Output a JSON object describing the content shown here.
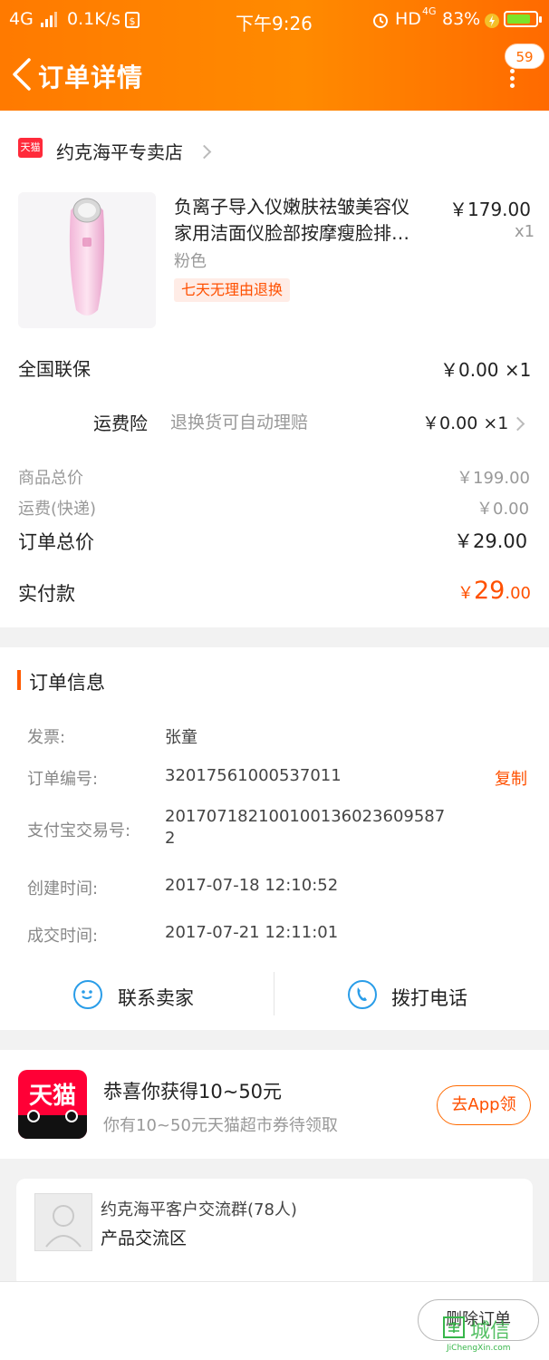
{
  "status_bar": {
    "network": "4G",
    "speed": "0.1K/s",
    "time": "下午9:26",
    "hd": "HD",
    "hd_net": "4G",
    "battery": "83%",
    "battery_level": 0.83
  },
  "header": {
    "title": "订单详情",
    "badge": "59"
  },
  "store": {
    "tag": "天猫",
    "name": "约克海平专卖店"
  },
  "product": {
    "title_line1": "负离子导入仪嫩肤祛皱美容仪",
    "title_line2": "家用洁面仪脸部按摩瘦脸排…",
    "price": "￥179.00",
    "qty": "x1",
    "spec": "粉色",
    "tag": "七天无理由退换"
  },
  "services": [
    {
      "name": "全国联保",
      "value": "￥0.00 ×1"
    },
    {
      "name": "运费险",
      "desc": "退换货可自动理赔",
      "value": "￥0.00 ×1"
    }
  ],
  "summary": {
    "goods_label": "商品总价",
    "goods_value": "￥199.00",
    "ship_label": "运费(快递)",
    "ship_value": "￥0.00",
    "total_label": "订单总价",
    "total_value": "￥29.00",
    "paid_label": "实付款",
    "paid_symbol": "￥",
    "paid_int": "29",
    "paid_dec": ".00"
  },
  "order_info": {
    "title": "订单信息",
    "invoice_label": "发票:",
    "invoice_value": "张童",
    "order_no_label": "订单编号:",
    "order_no_value": "32017561000537011",
    "copy": "复制",
    "alipay_label": "支付宝交易号:",
    "alipay_line1": "201707182100100136023609587",
    "alipay_line2": "2",
    "create_label": "创建时间:",
    "create_value": "2017-07-18 12:10:52",
    "deal_label": "成交时间:",
    "deal_value": "2017-07-21 12:11:01"
  },
  "actions": {
    "contact": "联系卖家",
    "call": "拨打电话"
  },
  "promo": {
    "logo_text": "天猫",
    "title": "恭喜你获得10~50元",
    "subtitle": "你有10~50元天猫超市券待领取",
    "button": "去App领"
  },
  "group": {
    "name": "约克海平客户交流群(78人)",
    "zone": "产品交流区"
  },
  "bottom": {
    "delete": "删除订单"
  },
  "watermark": {
    "main": "城信",
    "sub": "JiChengXin.com"
  },
  "colors": {
    "accent": "#ff6a00",
    "price_red": "#ff5000",
    "link_blue": "#2a9de8"
  }
}
